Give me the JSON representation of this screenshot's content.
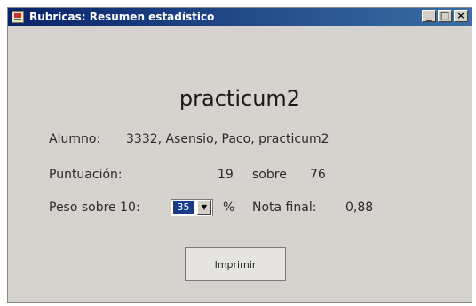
{
  "window": {
    "title": "Rubricas: Resumen estadístico",
    "controls": {
      "minimize": "_",
      "maximize": "□",
      "close": "×"
    }
  },
  "content": {
    "heading": "practicum2",
    "student": {
      "label": "Alumno:",
      "value": "3332, Asensio, Paco, practicum2"
    },
    "score": {
      "label": "Puntuación:",
      "points": "19",
      "over_label": "sobre",
      "max": "76"
    },
    "weight": {
      "label": "Peso sobre 10:",
      "selected": "35",
      "unit": "%",
      "final_label": "Nota final:",
      "final_value": "0,88"
    },
    "print_button": "Imprimir"
  }
}
